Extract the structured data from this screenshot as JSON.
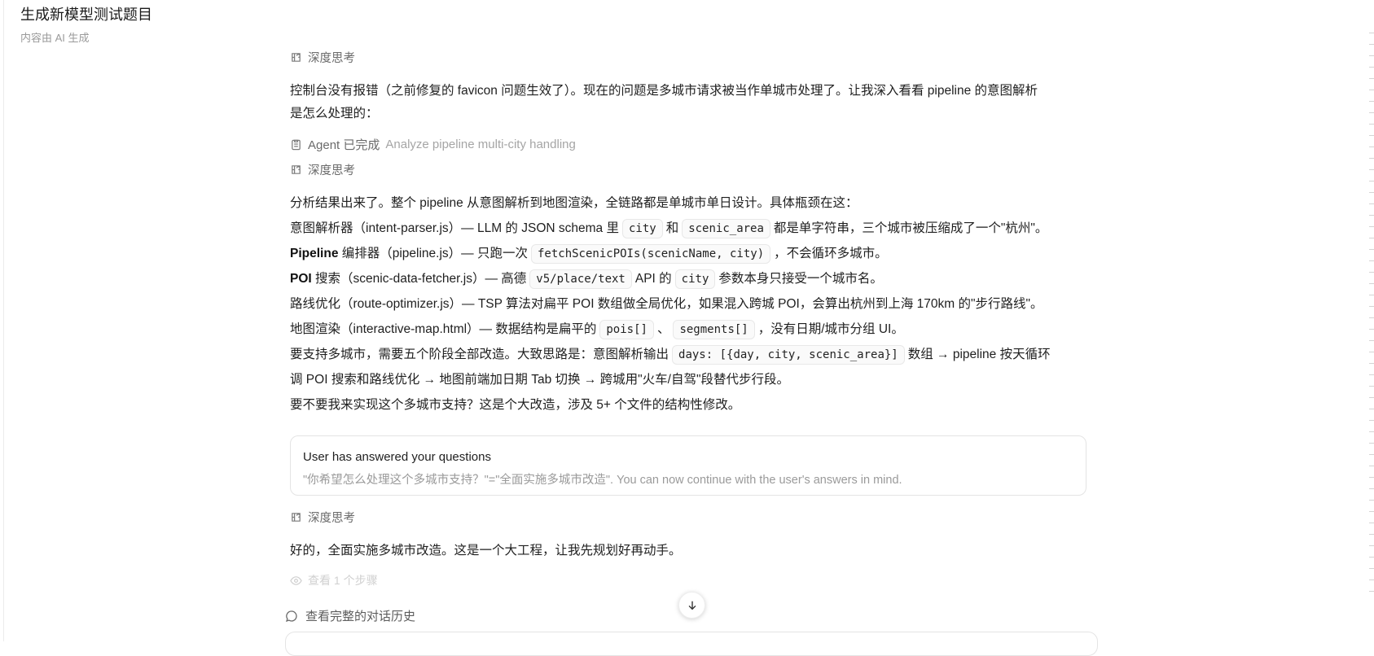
{
  "header": {
    "title": "生成新模型测试题目",
    "subtitle": "内容由 AI 生成"
  },
  "thinking_label": "深度思考",
  "messages": {
    "p1_line1": "控制台没有报错（之前修复的 favicon 问题生效了）。现在的问题是多城市请求被当作单城市处理了。让我深入看看 pipeline 的意图解析",
    "p1_line2": "是怎么处理的：",
    "agent_status": "Agent 已完成",
    "agent_task": "Analyze pipeline multi-city handling",
    "analysis": {
      "intro": "分析结果出来了。整个 pipeline 从意图解析到地图渲染，全链路都是单城市单日设计。具体瓶颈在这：",
      "l1_a": "意图解析器（intent-parser.js）— LLM 的 JSON schema 里",
      "l1_code1": "city",
      "l1_b": "和",
      "l1_code2": "scenic_area",
      "l1_c": "都是单字符串，三个城市被压缩成了一个\"杭州\"。",
      "l2_bold": "Pipeline",
      "l2_a": " 编排器（pipeline.js）— 只跑一次",
      "l2_code": "fetchScenicPOIs(scenicName, city)",
      "l2_b": "，不会循环多城市。",
      "l3_bold": "POI",
      "l3_a": " 搜索（scenic-data-fetcher.js）— 高德",
      "l3_code1": "v5/place/text",
      "l3_b": "API 的",
      "l3_code2": "city",
      "l3_c": "参数本身只接受一个城市名。",
      "l4": "路线优化（route-optimizer.js）— TSP 算法对扁平 POI 数组做全局优化，如果混入跨城 POI，会算出杭州到上海 170km 的\"步行路线\"。",
      "l5_a": "地图渲染（interactive-map.html）— 数据结构是扁平的",
      "l5_code1": "pois[]",
      "l5_b": "、",
      "l5_code2": "segments[]",
      "l5_c": "，没有日期/城市分组 UI。",
      "l6_a": "要支持多城市，需要五个阶段全部改造。大致思路是：意图解析输出",
      "l6_code": "days: [{day, city, scenic_area}]",
      "l6_b": "数组 → pipeline 按天循环",
      "l7": "调 POI 搜索和路线优化 → 地图前端加日期 Tab 切换 → 跨城用\"火车/自驾\"段替代步行段。",
      "l8": "要不要我来实现这个多城市支持？这是个大改造，涉及 5+ 个文件的结构性修改。"
    },
    "answer_box": {
      "heading": "User has answered your questions",
      "detail": "\"你希望怎么处理这个多城市支持？\"=\"全面实施多城市改造\". You can now continue with the user's answers in mind."
    },
    "p3": "好的，全面实施多城市改造。这是一个大工程，让我先规划好再动手。",
    "view_steps": "查看 1 个步骤"
  },
  "footer": {
    "history_label": "查看完整的对话历史"
  }
}
